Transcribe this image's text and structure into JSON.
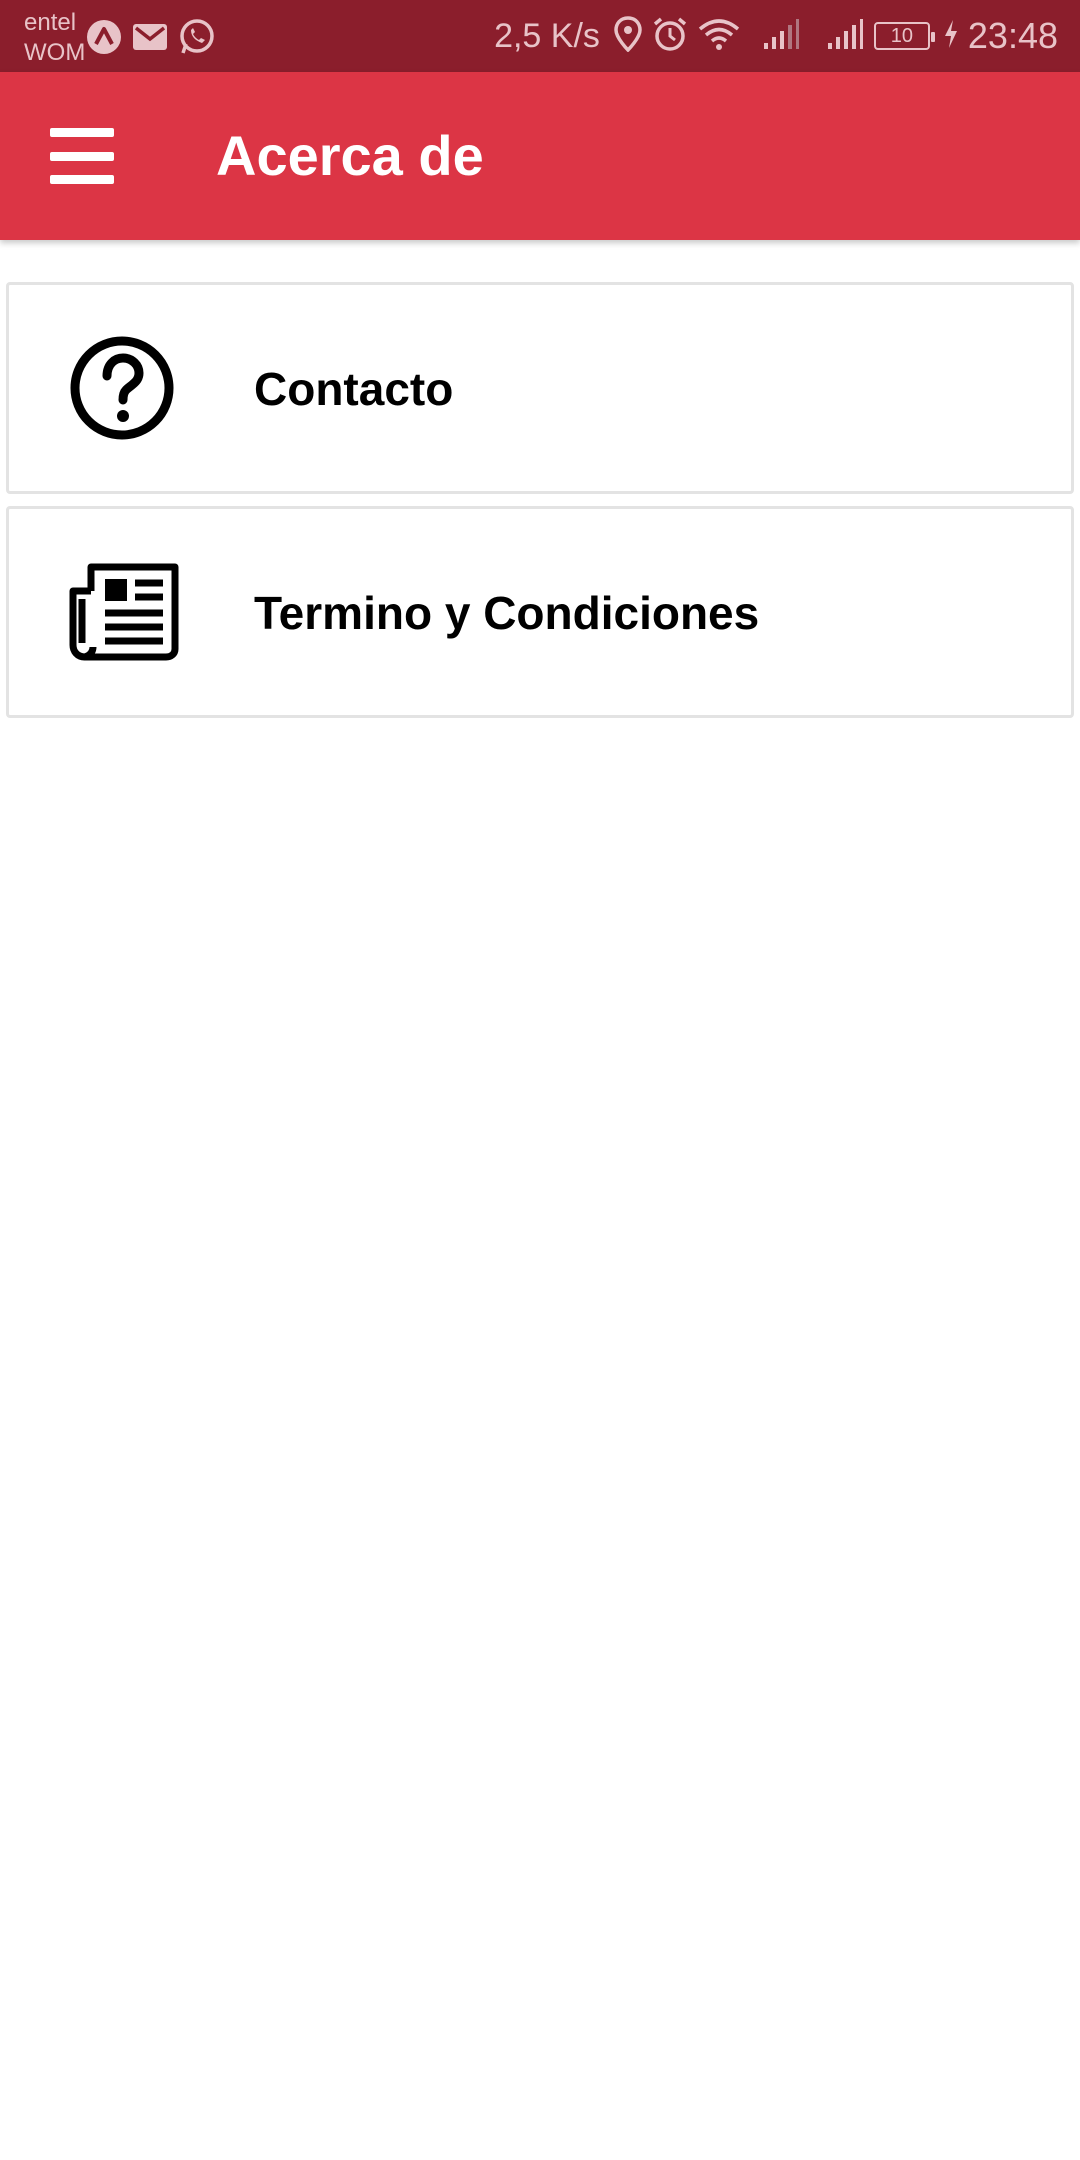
{
  "status_bar": {
    "carrier_1": "entel",
    "carrier_2": "WOM",
    "net_speed": "2,5 K/s",
    "battery": "10",
    "time": "23:48",
    "left_icons": [
      "app-icon",
      "gmail-icon",
      "whatsapp-icon"
    ],
    "right_icons": [
      "location-icon",
      "alarm-icon",
      "wifi-icon",
      "signal-icon",
      "signal-icon",
      "battery-icon",
      "charging-icon"
    ]
  },
  "app_bar": {
    "title": "Acerca de",
    "menu_icon": "hamburger-menu-icon",
    "background": "#dc3545"
  },
  "menu_items": [
    {
      "label": "Contacto",
      "icon": "question-circle-icon"
    },
    {
      "label": "Termino y Condiciones",
      "icon": "newspaper-icon"
    }
  ],
  "colors": {
    "status_bar": "#8b1e2c",
    "app_bar": "#dc3545",
    "text": "#000000",
    "card_border": "#e3e3e3"
  }
}
